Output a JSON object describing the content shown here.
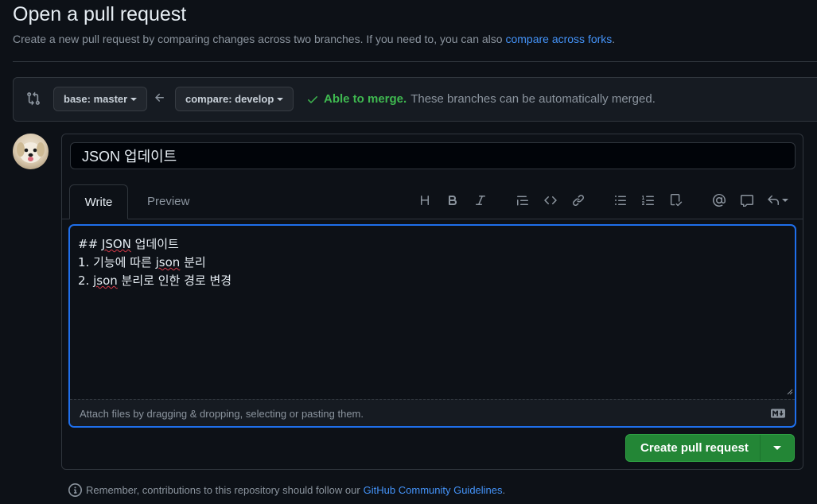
{
  "header": {
    "title": "Open a pull request",
    "subtitle": "Create a new pull request by comparing changes across two branches. If you need to, you can also",
    "subtitle_link": "compare across forks",
    "subtitle_end": "."
  },
  "compare": {
    "base_label": "base: master",
    "compare_label": "compare: develop",
    "merge_ok": "Able to merge.",
    "merge_text": "These branches can be automatically merged."
  },
  "form": {
    "title_value": "JSON 업데이트",
    "tabs": {
      "write": "Write",
      "preview": "Preview"
    },
    "toolbar": [
      "heading-icon",
      "bold-icon",
      "italic-icon",
      "quote-icon",
      "code-icon",
      "link-icon",
      "bullet-list-icon",
      "numbered-list-icon",
      "task-list-icon",
      "mention-icon",
      "reference-icon",
      "reply-icon"
    ],
    "body": {
      "line1_prefix": "## ",
      "line1_word": "JSON",
      "line1_rest": " 업데이트",
      "line2_prefix": "1. 기능에 따른 ",
      "line2_word": "json",
      "line2_rest": " 분리",
      "line3_prefix": "2. ",
      "line3_word": "json",
      "line3_rest": " 분리로 인한 경로 변경"
    },
    "attach_hint": "Attach files by dragging & dropping, selecting or pasting them.",
    "submit_label": "Create pull request"
  },
  "footer": {
    "note": "Remember, contributions to this repository should follow our",
    "link": "GitHub Community Guidelines",
    "end": "."
  },
  "colors": {
    "background": "#0d1117",
    "accent_blue": "#4493f8",
    "success_green": "#3fb950",
    "button_green": "#238636"
  }
}
